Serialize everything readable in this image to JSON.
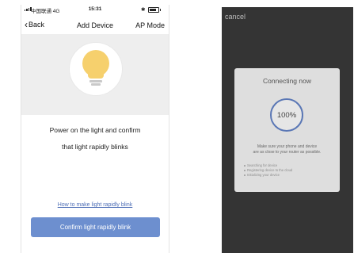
{
  "left_screen": {
    "status_bar": {
      "carrier": "中国联通 4G",
      "time": "15:31",
      "bluetooth": "✱"
    },
    "nav": {
      "back_label": "Back",
      "title": "Add Device",
      "ap_mode_label": "AP Mode"
    },
    "illustration": {
      "icon": "lightbulb-icon",
      "bulb_color": "#f6d06d"
    },
    "instruction": {
      "line1": "Power on the light and confirm",
      "line2": "that light rapidly blinks"
    },
    "help_link": "How to make light rapidly blink",
    "confirm_button": "Confirm light rapidly blink",
    "accent_color": "#6d8fcf"
  },
  "right_screen": {
    "cancel_label": "cancel",
    "dialog": {
      "title": "Connecting now",
      "progress_text": "100%",
      "progress_value": 100,
      "note_line1": "Make sure your phone and device",
      "note_line2": "are as close to your router as possible.",
      "steps": [
        "Searching for device",
        "Registering device to the cloud",
        "Initializing your device"
      ]
    },
    "background_color": "#343434",
    "ring_color": "#5a77b5"
  }
}
